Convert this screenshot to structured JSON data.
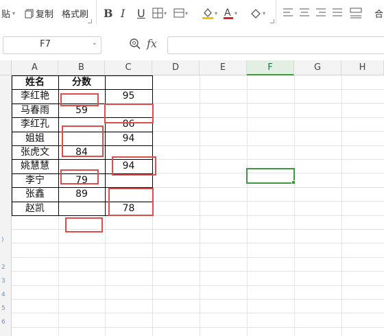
{
  "toolbar": {
    "paste_label": "贴",
    "copy_label": "复制",
    "format_painter_label": "格式刷",
    "bold_label": "B",
    "italic_label": "I",
    "underline_label": "U",
    "merge_label": "合",
    "font_color": "#e02020",
    "fill_color": "#f2c200"
  },
  "formula_bar": {
    "name_box": "F7",
    "fx_label": "fx",
    "formula": ""
  },
  "columns": [
    "A",
    "B",
    "C",
    "D",
    "E",
    "F",
    "G",
    "H"
  ],
  "selected_column": "F",
  "table": {
    "headers": [
      "姓名",
      "分数",
      ""
    ],
    "rows": [
      [
        "李红艳",
        "",
        "95"
      ],
      [
        "马春雨",
        "59",
        ""
      ],
      [
        "李红孔",
        "",
        "86"
      ],
      [
        "姐姐",
        "",
        "94"
      ],
      [
        "张虎文",
        "84",
        ""
      ],
      [
        "姚慧慧",
        "",
        "94"
      ],
      [
        "李宁",
        "79",
        ""
      ],
      [
        "张鑫",
        "89",
        ""
      ],
      [
        "赵凯",
        "",
        "78"
      ]
    ]
  },
  "colors": {
    "highlight_box": "#e04a4a",
    "selection": "#3a9a3a"
  }
}
